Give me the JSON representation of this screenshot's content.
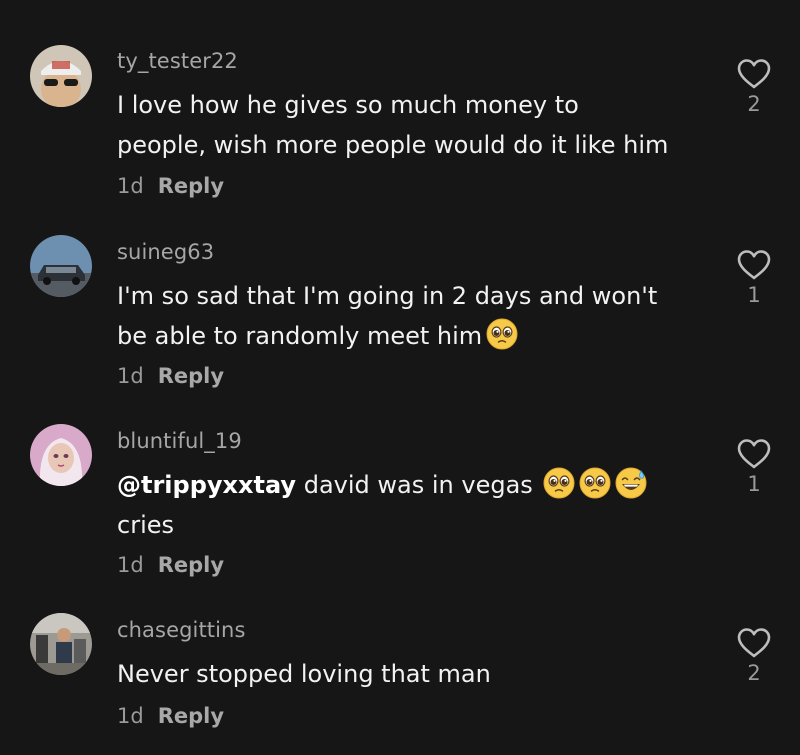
{
  "comments": [
    {
      "username": "ty_tester22",
      "lines": [
        "I love how he gives so much money to",
        "people, wish more people would do it like him"
      ],
      "age": "1d",
      "reply_label": "Reply",
      "likes": "2"
    },
    {
      "username": "suineg63",
      "lines": [
        "I'm so sad that I'm going in 2 days and won't",
        "be able to randomly meet him"
      ],
      "age": "1d",
      "reply_label": "Reply",
      "likes": "1"
    },
    {
      "username": "bluntiful_19",
      "mention": "@trippyxxtay",
      "lines": [
        " david was in vegas",
        "cries"
      ],
      "age": "1d",
      "reply_label": "Reply",
      "likes": "1"
    },
    {
      "username": "chasegittins",
      "lines": [
        "Never stopped loving that man"
      ],
      "age": "1d",
      "reply_label": "Reply",
      "likes": "2"
    }
  ],
  "icons": {
    "like": "heart-outline-icon",
    "pleading": "pleading-face-emoji",
    "sweat_smile": "grinning-sweat-emoji"
  },
  "colors": {
    "background": "#161616",
    "username": "#a6a6a6",
    "text": "#f2f2f2",
    "meta": "#9a9a9a"
  }
}
